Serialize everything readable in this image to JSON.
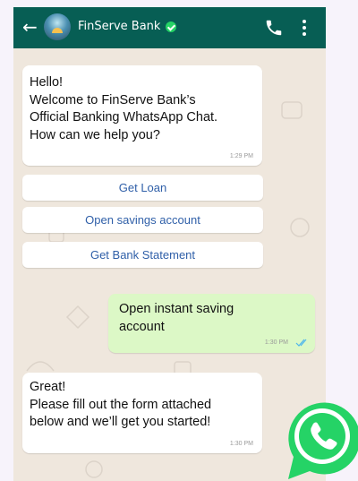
{
  "header": {
    "title": "FinServe Bank"
  },
  "messages": {
    "m1": {
      "text": "Hello!\nWelcome to FinServe Bank’s\nOfficial Banking WhatsApp Chat.\nHow can we help you?",
      "time": "1:29 PM"
    },
    "m2": {
      "text": "Open instant saving\naccount",
      "time": "1:30 PM"
    },
    "m3": {
      "text": "Great!\nPlease fill out the form attached\nbelow and we’ll get you started!",
      "time": "1:30 PM"
    }
  },
  "quick_replies": [
    "Get Loan",
    "Open savings account",
    "Get Bank Statement"
  ],
  "icons": {
    "back": "arrow-left-icon",
    "verified": "verified-check-icon",
    "call": "phone-icon",
    "menu": "more-vert-icon",
    "read": "double-check-icon",
    "whatsapp": "whatsapp-logo-icon"
  },
  "colors": {
    "header": "#075e54",
    "outgoing": "#dcf8c6",
    "link": "#2f5fa8",
    "whatsapp": "#25d366"
  }
}
